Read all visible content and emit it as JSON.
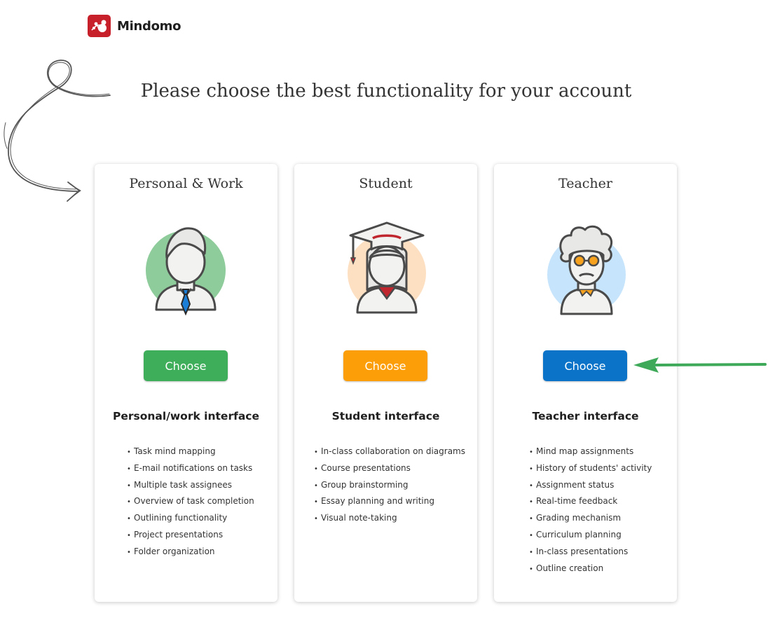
{
  "brand": {
    "name": "Mindomo",
    "color": "#c8202b"
  },
  "headline": "Please choose the best functionality for your account",
  "cards": [
    {
      "title": "Personal & Work",
      "button_label": "Choose",
      "button_color": "#3fae5a",
      "avatar_icon": "businessman-avatar-icon",
      "avatar_color": "#8fcc9c",
      "interface_title": "Personal/work interface",
      "features": [
        "Task mind mapping",
        "E-mail notifications on tasks",
        "Multiple task assignees",
        "Overview of task completion",
        "Outlining functionality",
        "Project presentations",
        "Folder organization"
      ]
    },
    {
      "title": "Student",
      "button_label": "Choose",
      "button_color": "#fb9e07",
      "avatar_icon": "graduate-student-avatar-icon",
      "avatar_color": "#fde0c2",
      "interface_title": "Student interface",
      "features": [
        "In-class collaboration on diagrams",
        "Course presentations",
        "Group brainstorming",
        "Essay planning and writing",
        "Visual note-taking"
      ]
    },
    {
      "title": "Teacher",
      "button_label": "Choose",
      "button_color": "#0b74c9",
      "avatar_icon": "teacher-avatar-icon",
      "avatar_color": "#c6e4fb",
      "interface_title": "Teacher interface",
      "features": [
        "Mind map assignments",
        "History of students' activity",
        "Assignment status",
        "Real-time feedback",
        "Grading mechanism",
        "Curriculum planning",
        "In-class presentations",
        "Outline creation"
      ]
    }
  ],
  "annotation_arrow_color": "#3fa95a"
}
